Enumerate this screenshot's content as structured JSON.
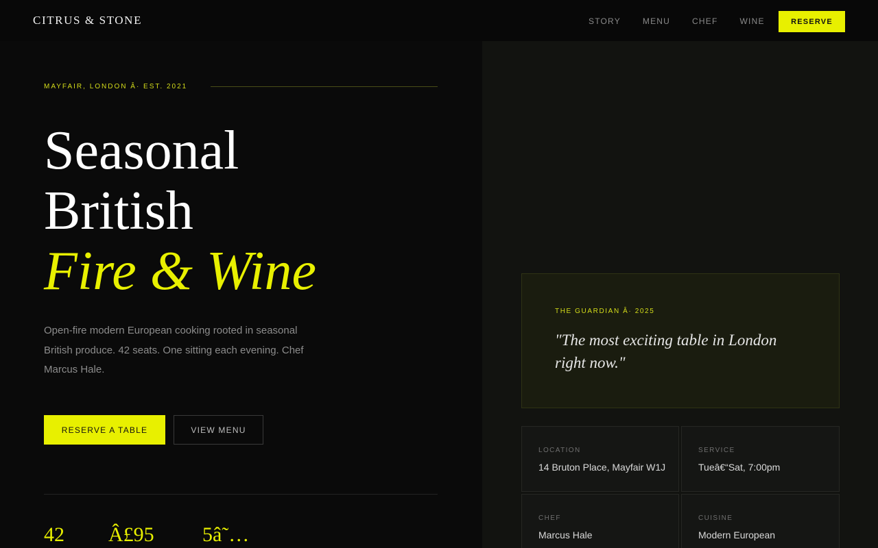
{
  "header": {
    "logo": "CITRUS & STONE",
    "nav": [
      "STORY",
      "MENU",
      "CHEF",
      "WINE"
    ],
    "reserve_label": "RESERVE"
  },
  "hero": {
    "eyebrow": "MAYFAIR, LONDON Â· EST. 2021",
    "headline_line1": "Seasonal",
    "headline_line2": "British",
    "headline_accent": "Fire & Wine",
    "intro": "Open-fire modern European cooking rooted in seasonal British produce. 42 seats. One sitting each evening. Chef Marcus Hale.",
    "primary_cta": "RESERVE A TABLE",
    "secondary_cta": "VIEW MENU",
    "stats": [
      "42",
      "Â£95",
      "5â˜…"
    ]
  },
  "quote": {
    "source": "THE GUARDIAN Â· 2025",
    "text": "\"The most exciting table in London right now.\""
  },
  "info": [
    {
      "label": "LOCATION",
      "value": "14 Bruton Place, Mayfair W1J"
    },
    {
      "label": "SERVICE",
      "value": "Tueâ€“Sat, 7:00pm"
    },
    {
      "label": "CHEF",
      "value": "Marcus Hale"
    },
    {
      "label": "CUISINE",
      "value": "Modern European"
    }
  ],
  "colors": {
    "accent": "#e8f000",
    "background": "#0a0a0a",
    "panel": "#121310"
  }
}
